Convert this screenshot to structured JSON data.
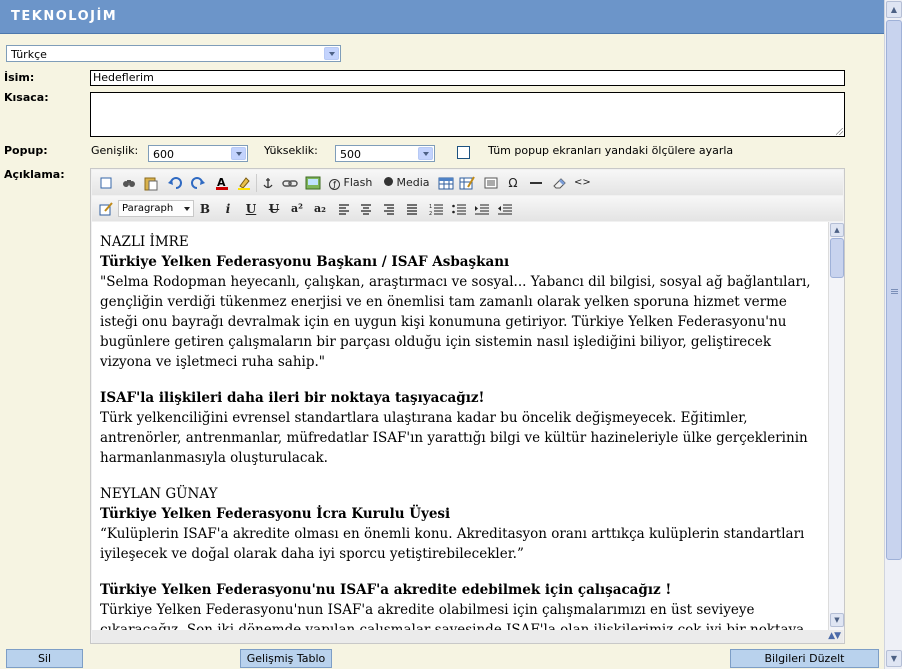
{
  "header": {
    "logo_text": "TEKNOLOJİM",
    "bg_color": "#6c95c9"
  },
  "language_select": {
    "value": "Türkçe"
  },
  "form": {
    "name_label": "İsim:",
    "name_value": "Hedeflerim",
    "short_label": "Kısaca:",
    "short_value": "",
    "popup_label": "Popup:",
    "width_label": "Genişlik:",
    "width_value": "600",
    "height_label": "Yükseklik:",
    "height_value": "500",
    "all_popups_label": "Tüm popup ekranları yandaki ölçülere ayarla",
    "all_popups_checked": false,
    "description_label": "Açıklama:"
  },
  "editor": {
    "toolbar1": {
      "flash_label": "Flash",
      "media_label": "Media",
      "icons": [
        "newdocument-icon",
        "find-icon",
        "paste-icon",
        "undo-icon",
        "redo-icon",
        "forecolor-icon",
        "backcolor-icon",
        "anchor-icon",
        "link-icon",
        "image-icon",
        "flash-icon",
        "media-icon",
        "table-icon",
        "table-props-icon",
        "layer-icon",
        "charmap-icon",
        "hr-icon",
        "cleanup-icon",
        "code-icon"
      ]
    },
    "toolbar2": {
      "format_value": "Paragraph",
      "bold": "B",
      "italic": "i",
      "underline": "U",
      "strike": "U",
      "superscript": "a²",
      "subscript": "a₂"
    },
    "content": [
      {
        "lines": [
          "NAZLI İMRE"
        ],
        "bold_first": false
      },
      {
        "heading": "Türkiye Yelken Federasyonu Başkanı / ISAF Asbaşkanı",
        "text": "\"Selma Rodopman heyecanlı, çalışkan, araştırmacı ve sosyal... Yabancı dil bilgisi, sosyal ağ bağlantıları, gençliğin verdiği tükenmez enerjisi ve en önemlisi tam zamanlı olarak yelken sporuna hizmet verme isteği onu bayrağı devralmak için en uygun kişi konumuna getiriyor. Türkiye Yelken Federasyonu'nu bugünlere getiren çalışmaların bir parçası olduğu için sistemin nasıl işlediğini biliyor, geliştirecek vizyona ve işletmeci ruha sahip.\""
      },
      {
        "heading": "ISAF'la ilişkileri daha ileri bir noktaya taşıyacağız!",
        "text": "Türk yelkenciliğini evrensel standartlara ulaştırana kadar bu öncelik değişmeyecek. Eğitimler, antrenörler, antrenmanlar, müfredatlar ISAF'ın yarattığı bilgi ve kültür hazineleriyle ülke gerçeklerinin harmanlanmasıyla oluşturulacak."
      },
      {
        "plain": "NEYLAN GÜNAY",
        "heading": "Türkiye Yelken Federasyonu İcra Kurulu Üyesi",
        "text": "“Kulüplerin ISAF'a akredite olması en önemli konu. Akreditasyon oranı arttıkça kulüplerin standartları iyileşecek ve doğal olarak daha iyi sporcu yetiştirebilecekler.”"
      },
      {
        "heading": "Türkiye Yelken Federasyonu'nu ISAF'a akredite edebilmek için çalışacağız !",
        "text": "Türkiye Yelken Federasyonu'nun ISAF'a akredite olabilmesi için çalışmalarımızı en üst seviyeye çıkaracağız. Son iki dönemde yapılan çalışmalar sayesinde ISAF'la olan ilişkilerimiz çok iyi bir noktaya getirildi. Bu işbirliğini olabildiğince geliştirmek ve işbirliğinden olabildiğince faydalanmak istiyoruz. Türkiye Yelken Federasyonu'nun ISAF'a akredite olması demek kulüplerimizin de akredite edilebilmesi demek. Kulüplerimiz ISAF'a akredite oldukça hem daha fazla"
      }
    ]
  },
  "buttons": {
    "delete": "Sil",
    "advanced_table": "Gelişmiş Tablo",
    "update": "Bilgileri Düzelt"
  }
}
